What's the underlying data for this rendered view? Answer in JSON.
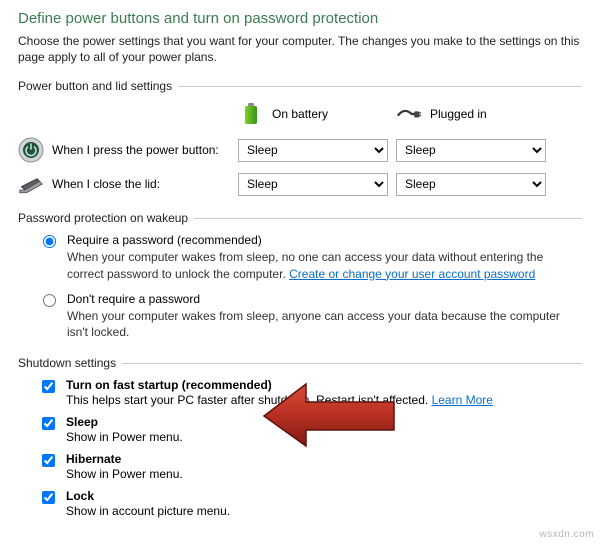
{
  "heading": "Define power buttons and turn on password protection",
  "intro": "Choose the power settings that you want for your computer. The changes you make to the settings on this page apply to all of your power plans.",
  "section1": {
    "title": "Power button and lid settings",
    "col_battery": "On battery",
    "col_plugged": "Plugged in",
    "row_power": {
      "label": "When I press the power button:",
      "battery": "Sleep",
      "plugged": "Sleep"
    },
    "row_lid": {
      "label": "When I close the lid:",
      "battery": "Sleep",
      "plugged": "Sleep"
    }
  },
  "section2": {
    "title": "Password protection on wakeup",
    "opt1": {
      "label": "Require a password (recommended)",
      "desc_before": "When your computer wakes from sleep, no one can access your data without entering the correct password to unlock the computer. ",
      "link": "Create or change your user account password"
    },
    "opt2": {
      "label": "Don't require a password",
      "desc": "When your computer wakes from sleep, anyone can access your data because the computer isn't locked."
    }
  },
  "section3": {
    "title": "Shutdown settings",
    "fast": {
      "label": "Turn on fast startup (recommended)",
      "desc": "This helps start your PC faster after shutdown. Restart isn't affected. ",
      "link": "Learn More"
    },
    "sleep": {
      "label": "Sleep",
      "desc": "Show in Power menu."
    },
    "hibernate": {
      "label": "Hibernate",
      "desc": "Show in Power menu."
    },
    "lock": {
      "label": "Lock",
      "desc": "Show in account picture menu."
    }
  },
  "watermark": "wsxdn.com"
}
